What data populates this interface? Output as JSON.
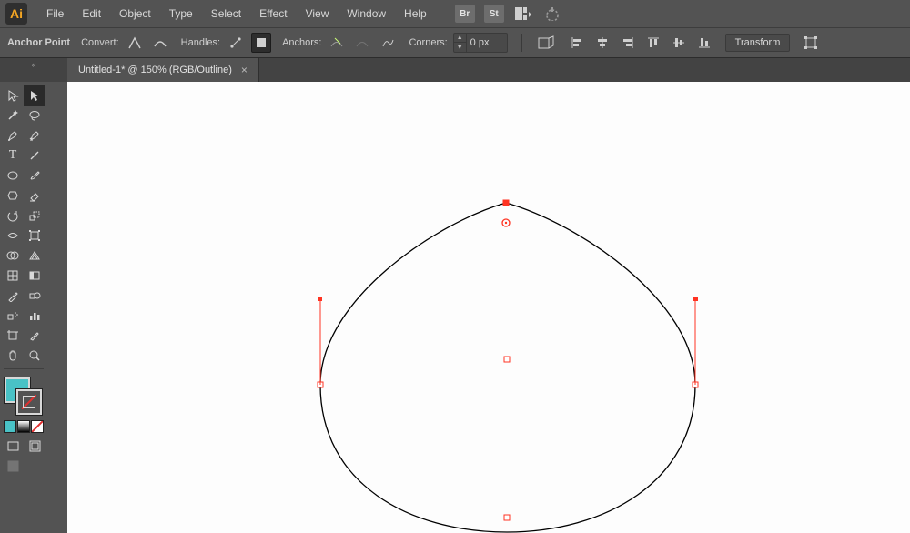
{
  "app": {
    "logo_text": "Ai"
  },
  "menu": [
    "File",
    "Edit",
    "Object",
    "Type",
    "Select",
    "Effect",
    "View",
    "Window",
    "Help"
  ],
  "menubar_badges": [
    "Br",
    "St"
  ],
  "optbar": {
    "mode": "Anchor Point",
    "convert": "Convert:",
    "handles": "Handles:",
    "anchors": "Anchors:",
    "corners": "Corners:",
    "corners_value": "0 px",
    "transform": "Transform"
  },
  "tab": {
    "title": "Untitled-1* @ 150% (RGB/Outline)",
    "close": "×"
  },
  "collapse": "«",
  "colors": {
    "fill": "#49c2c6",
    "accent": "#f5a623",
    "canvas": "#fdfdfd",
    "anchor": "#ff3322"
  },
  "tools_grid": [
    [
      "selection",
      "direct-selection"
    ],
    [
      "magic-wand",
      "lasso"
    ],
    [
      "pen",
      "curvature"
    ],
    [
      "type",
      "line"
    ],
    [
      "rectangle",
      "paintbrush"
    ],
    [
      "shaper",
      "eraser"
    ],
    [
      "rotate",
      "scale"
    ],
    [
      "width",
      "free-transform"
    ],
    [
      "shape-builder",
      "perspective"
    ],
    [
      "mesh",
      "gradient"
    ],
    [
      "eyedropper",
      "blend"
    ],
    [
      "symbol-sprayer",
      "column-graph"
    ],
    [
      "artboard",
      "slice"
    ],
    [
      "hand",
      "zoom"
    ]
  ],
  "bottom_icons": [
    "normal",
    "fullscreen",
    "present"
  ]
}
